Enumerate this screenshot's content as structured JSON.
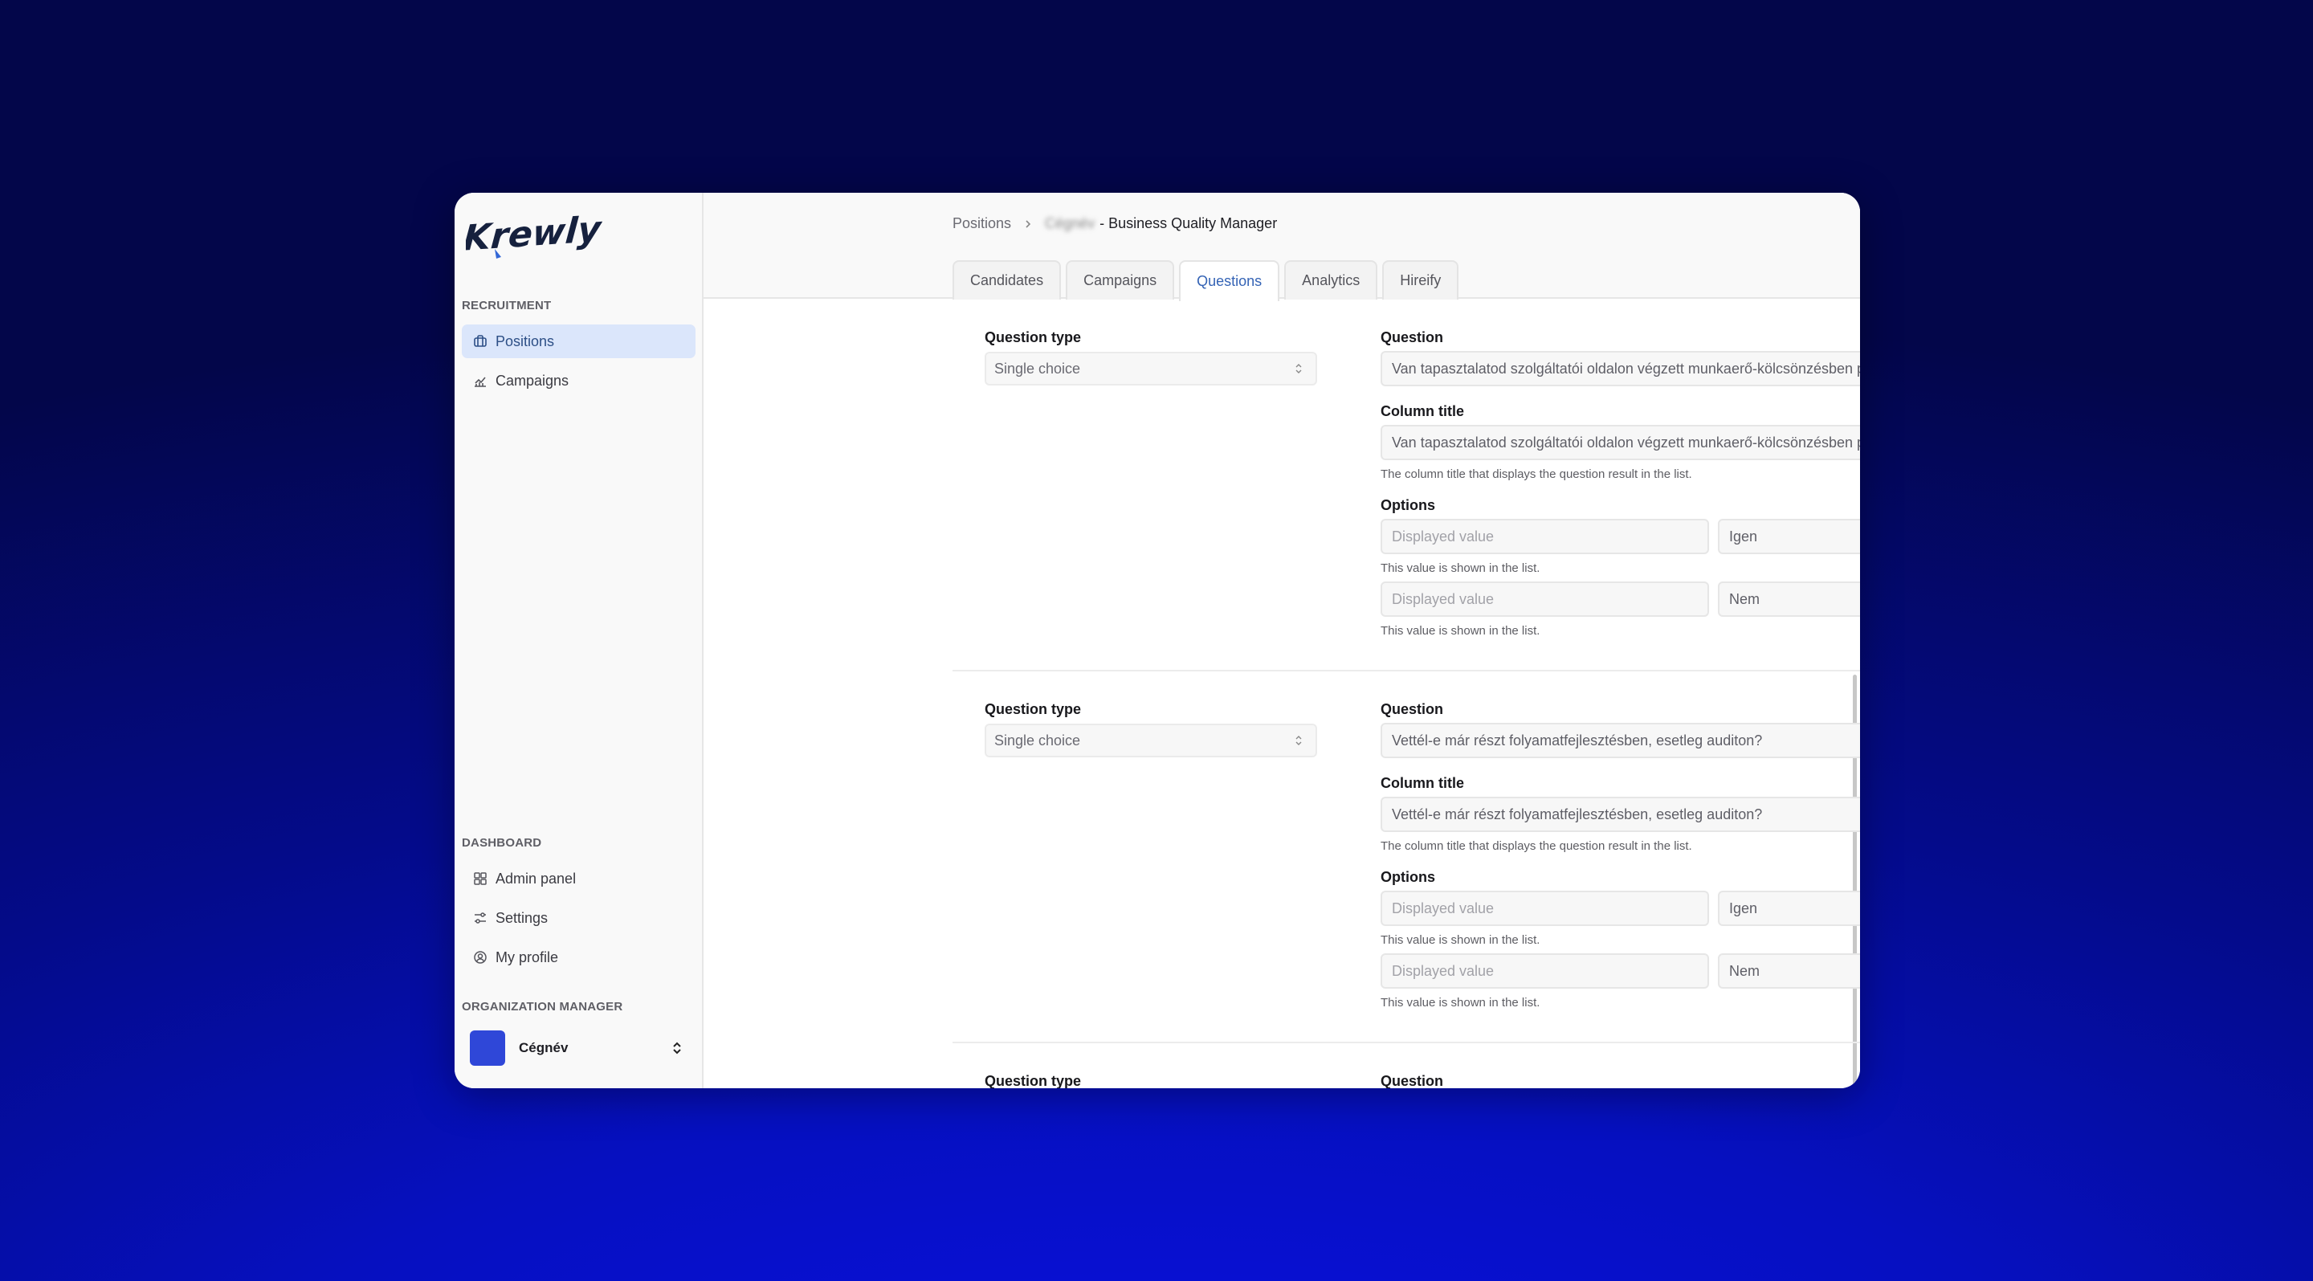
{
  "app": {
    "logo_text": "Krewly"
  },
  "sidebar": {
    "sections": {
      "recruitment": "RECRUITMENT",
      "dashboard": "DASHBOARD",
      "organization": "ORGANIZATION MANAGER"
    },
    "recruitment_items": [
      {
        "label": "Positions",
        "icon": "briefcase-icon",
        "active": true
      },
      {
        "label": "Campaigns",
        "icon": "chart-line-icon",
        "active": false
      }
    ],
    "dashboard_items": [
      {
        "label": "Admin panel",
        "icon": "grid-icon"
      },
      {
        "label": "Settings",
        "icon": "sliders-icon"
      },
      {
        "label": "My profile",
        "icon": "user-circle-icon"
      }
    ],
    "org": {
      "name": "Cégnév",
      "avatar_color": "#2f47d8"
    }
  },
  "header": {
    "breadcrumb": {
      "root": "Positions",
      "blurred_company": "Cégnév",
      "position": "- Business Quality Manager"
    },
    "tabs": [
      {
        "label": "Candidates",
        "active": false
      },
      {
        "label": "Campaigns",
        "active": false
      },
      {
        "label": "Questions",
        "active": true
      },
      {
        "label": "Analytics",
        "active": false
      },
      {
        "label": "Hireify",
        "active": false
      }
    ]
  },
  "questions": [
    {
      "type_label": "Question type",
      "type_value": "Single choice",
      "question_label": "Question",
      "question_value": "Van tapasztalatod szolgáltatói oldalon végzett munkaerő-kölcsönzésben projektvezetőként?",
      "column_title_label": "Column title",
      "column_title_value": "Van tapasztalatod szolgáltatói oldalon végzett munkaerő-kölcsönzésben projektvezetőként?",
      "column_title_help": "The column title that displays the question result in the list.",
      "options_label": "Options",
      "options": [
        {
          "displayed_placeholder": "Displayed value",
          "value": "Igen",
          "help": "This value is shown in the list."
        },
        {
          "displayed_placeholder": "Displayed value",
          "value": "Nem",
          "help": "This value is shown in the list."
        }
      ]
    },
    {
      "type_label": "Question type",
      "type_value": "Single choice",
      "question_label": "Question",
      "question_value": "Vettél-e már részt folyamatfejlesztésben, esetleg auditon?",
      "column_title_label": "Column title",
      "column_title_value": "Vettél-e már részt folyamatfejlesztésben, esetleg auditon?",
      "column_title_help": "The column title that displays the question result in the list.",
      "options_label": "Options",
      "options": [
        {
          "displayed_placeholder": "Displayed value",
          "value": "Igen",
          "help": "This value is shown in the list."
        },
        {
          "displayed_placeholder": "Displayed value",
          "value": "Nem",
          "help": "This value is shown in the list."
        }
      ]
    },
    {
      "type_label": "Question type",
      "question_label": "Question"
    }
  ],
  "colors": {
    "accent": "#3463b5",
    "active_nav_bg": "#dbe6fb",
    "background": "#0610c0"
  }
}
